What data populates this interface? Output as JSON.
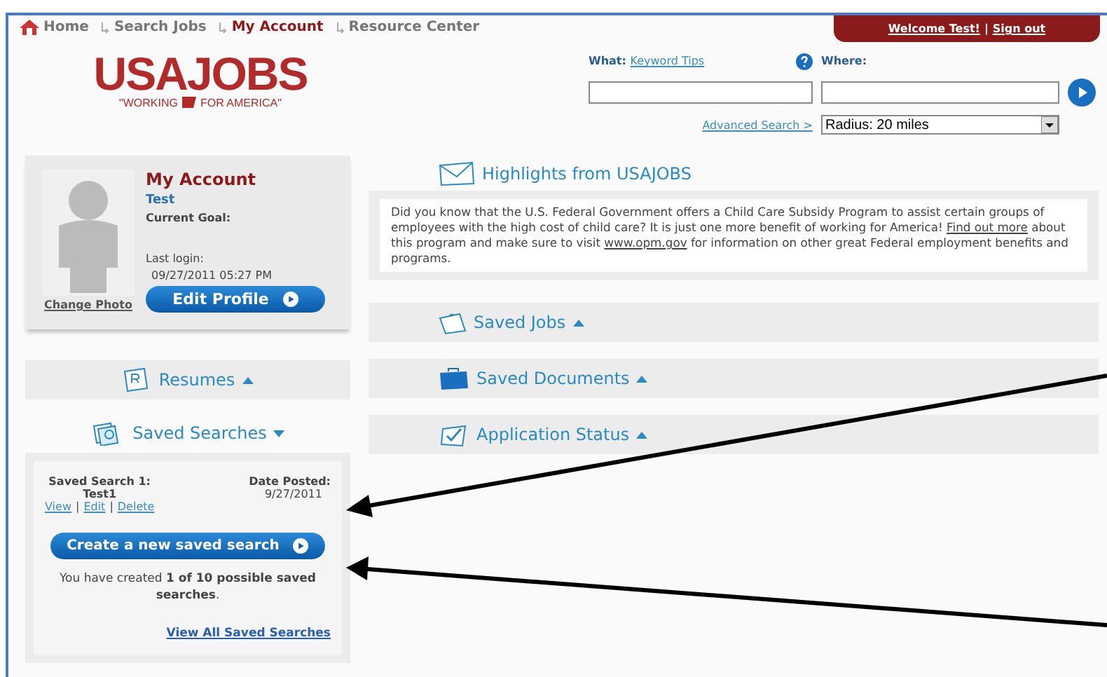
{
  "nav": [
    {
      "label": "Home",
      "selected": false
    },
    {
      "label": "Search Jobs",
      "selected": false
    },
    {
      "label": "My Account",
      "selected": true
    },
    {
      "label": "Resource Center",
      "selected": false
    }
  ],
  "user_bar": {
    "welcome": "Welcome Test!",
    "separator": "|",
    "sign_out": "Sign out"
  },
  "logo": {
    "name": "USAJOBS",
    "tagline_left": "\"WORKING",
    "tagline_right": "FOR AMERICA\""
  },
  "search": {
    "what_label": "What:",
    "keyword_tips": "Keyword Tips",
    "where_label": "Where:",
    "advanced": "Advanced Search >",
    "radius": "Radius: 20 miles"
  },
  "account": {
    "title": "My Account",
    "name": "Test",
    "goal_label": "Current Goal:",
    "last_login_label": "Last login:",
    "last_login": "09/27/2011 05:27 PM",
    "change_photo": "Change Photo",
    "edit_profile": "Edit Profile"
  },
  "resumes": {
    "title": "Resumes",
    "expanded": false
  },
  "saved_searches": {
    "title": "Saved Searches",
    "expanded": true,
    "items": [
      {
        "name_label": "Saved Search 1:",
        "name": "Test1",
        "date_label": "Date Posted:",
        "date": "9/27/2011",
        "actions": [
          "View",
          "Edit",
          "Delete"
        ],
        "separator": "|"
      }
    ],
    "create": "Create a new saved search",
    "summary": "You have created **1 of 10 possible saved searches**.",
    "view_all": "View All Saved Searches"
  },
  "highlights": {
    "title": "Highlights from USAJOBS",
    "body": [
      {
        "kind": "text",
        "text": "Did you know that the U.S. Federal Government offers a Child Care Subsidy Program to assist certain groups of employees with the high cost of child care? It is just one more benefit of working for America! "
      },
      {
        "kind": "link",
        "text": "Find out more"
      },
      {
        "kind": "text",
        "text": " about this program and make sure to visit "
      },
      {
        "kind": "link",
        "text": "www.opm.gov"
      },
      {
        "kind": "text",
        "text": " for information on other great Federal employment benefits and programs."
      }
    ]
  },
  "sections": [
    {
      "kind": "jobs",
      "title": "Saved Jobs",
      "expanded": false
    },
    {
      "kind": "documents",
      "title": "Saved Documents",
      "expanded": false
    },
    {
      "kind": "status",
      "title": "Application Status",
      "expanded": false
    }
  ]
}
